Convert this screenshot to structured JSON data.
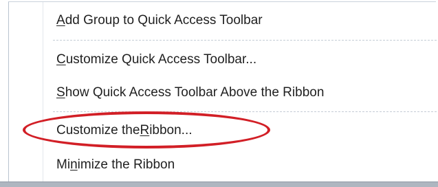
{
  "menu": {
    "items": [
      {
        "pre": "",
        "accel": "A",
        "post": "dd Group to Quick Access Toolbar",
        "disabled": false
      },
      {
        "pre": "",
        "accel": "C",
        "post": "ustomize Quick Access Toolbar...",
        "disabled": false
      },
      {
        "pre": "",
        "accel": "S",
        "post": "how Quick Access Toolbar Above the Ribbon",
        "disabled": false
      },
      {
        "pre": "Customize the ",
        "accel": "R",
        "post": "ibbon...",
        "disabled": false
      },
      {
        "pre": "Mi",
        "accel": "n",
        "post": "imize the Ribbon",
        "disabled": false
      }
    ]
  },
  "annotation": {
    "color": "#d21f26",
    "shape": "ellipse",
    "target_item": "Customize the Ribbon..."
  },
  "colors": {
    "menu_background": "#ffffff",
    "text": "#1f1f1f",
    "separator": "#c5ccd5",
    "status_bar": "#aeb6c0"
  }
}
